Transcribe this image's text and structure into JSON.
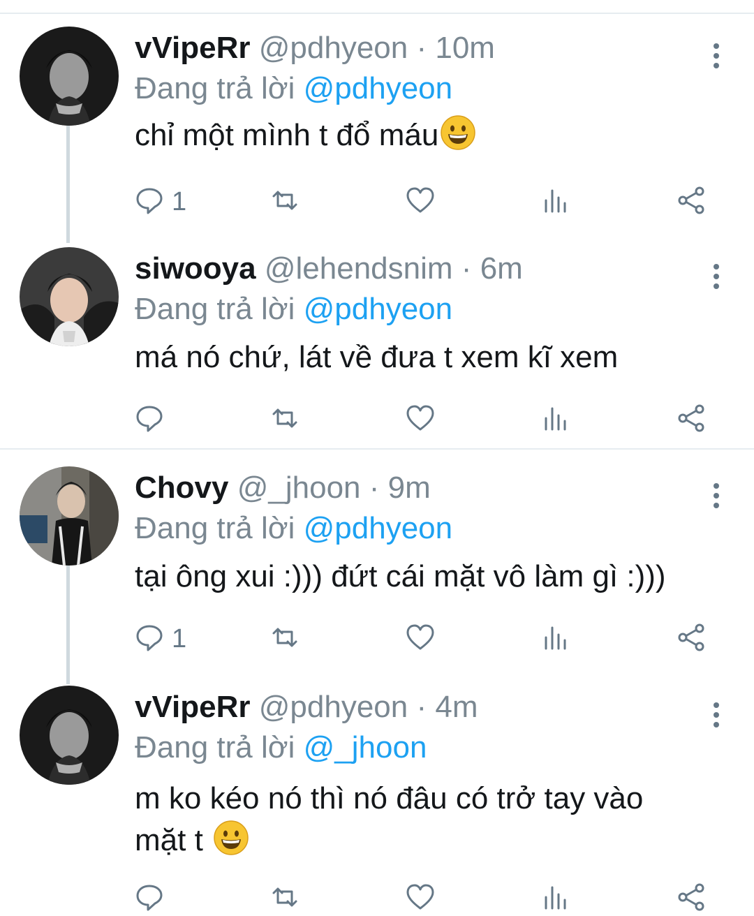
{
  "colors": {
    "accent": "#1da1f2",
    "muted": "#7a8791",
    "text": "#14171a",
    "divider": "#e6ecf0",
    "thread_line": "#cfd9de"
  },
  "tweets": [
    {
      "name": "vVipeRr",
      "handle": "@pdhyeon",
      "separator": "·",
      "time": "10m",
      "replying_label": "Đang trả lời",
      "replying_to": "@pdhyeon",
      "text": "chỉ một mình t đổ máu",
      "emoji": "grinning-face",
      "reply_count": "1"
    },
    {
      "name": "siwooya",
      "handle": "@lehendsnim",
      "separator": "·",
      "time": "6m",
      "replying_label": "Đang trả lời",
      "replying_to": "@pdhyeon",
      "text": "má nó chứ, lát về đưa t xem kĩ xem",
      "emoji": "",
      "reply_count": ""
    },
    {
      "name": "Chovy",
      "handle": "@_jhoon",
      "separator": "·",
      "time": "9m",
      "replying_label": "Đang trả lời",
      "replying_to": "@pdhyeon",
      "text": "tại ông xui :))) đứt cái mặt vô làm gì :)))",
      "emoji": "",
      "reply_count": "1"
    },
    {
      "name": "vVipeRr",
      "handle": "@pdhyeon",
      "separator": "·",
      "time": "4m",
      "replying_label": "Đang trả lời",
      "replying_to": "@_jhoon",
      "text_line1": "m ko kéo nó thì nó đâu có trở tay vào",
      "text_line2": "mặt t",
      "emoji": "grinning-face",
      "reply_count": ""
    }
  ],
  "icons": {
    "reply": "speech-bubble-icon",
    "retweet": "retweet-icon",
    "like": "heart-icon",
    "stats": "bar-chart-icon",
    "share": "share-icon",
    "more": "vertical-ellipsis-icon"
  }
}
